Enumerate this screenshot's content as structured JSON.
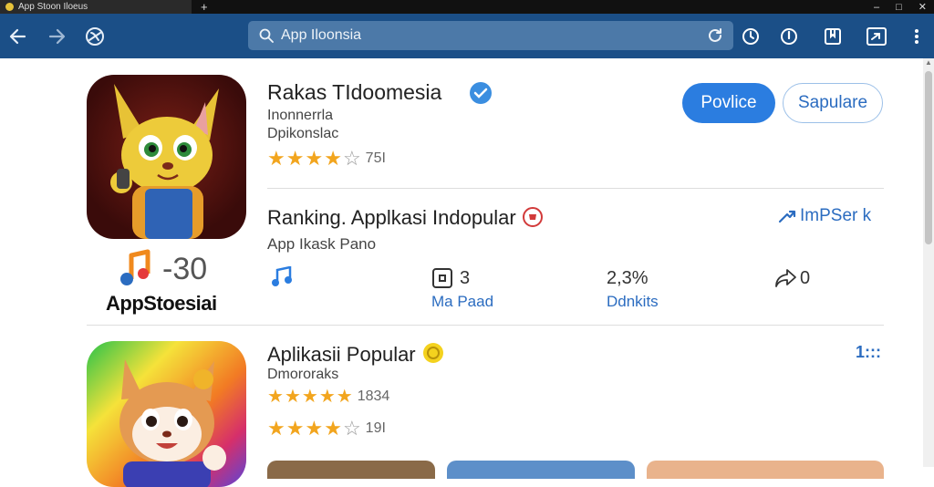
{
  "browser": {
    "tab_title": "App Stoon Iloeus",
    "new_tab": "+",
    "window_controls": [
      "–",
      "□",
      "✕"
    ],
    "address_placeholder": "App Iloonsia"
  },
  "app1": {
    "title": "Rakas TIdoomesia",
    "subtitle1": "Inonnerrla",
    "subtitle2": "Dpikonslac",
    "stars": 4,
    "rating": "75I",
    "primary_button": "Povlice",
    "secondary_button": "Sapulare"
  },
  "ranking": {
    "title": "Ranking. Applkasi Indopular",
    "subtitle": "App Ikask Pano",
    "link": "ImPSer k"
  },
  "brand": {
    "number": "-30",
    "name": "AppStoesiai"
  },
  "stats": [
    {
      "value": "3",
      "label": "Ma Paad"
    },
    {
      "value": "2,3%",
      "label": "Ddnkits"
    },
    {
      "value": "0",
      "label": ""
    }
  ],
  "popular": {
    "title": "Aplikasii Popular",
    "subtitle": "Dmororaks",
    "rating1": "1834",
    "rating2": "19I",
    "more": "1:::"
  },
  "colors": {
    "toolbar": "#1b4f87",
    "address_bar": "#4c79a8",
    "accent": "#2b7de0",
    "star": "#f2a51e"
  }
}
